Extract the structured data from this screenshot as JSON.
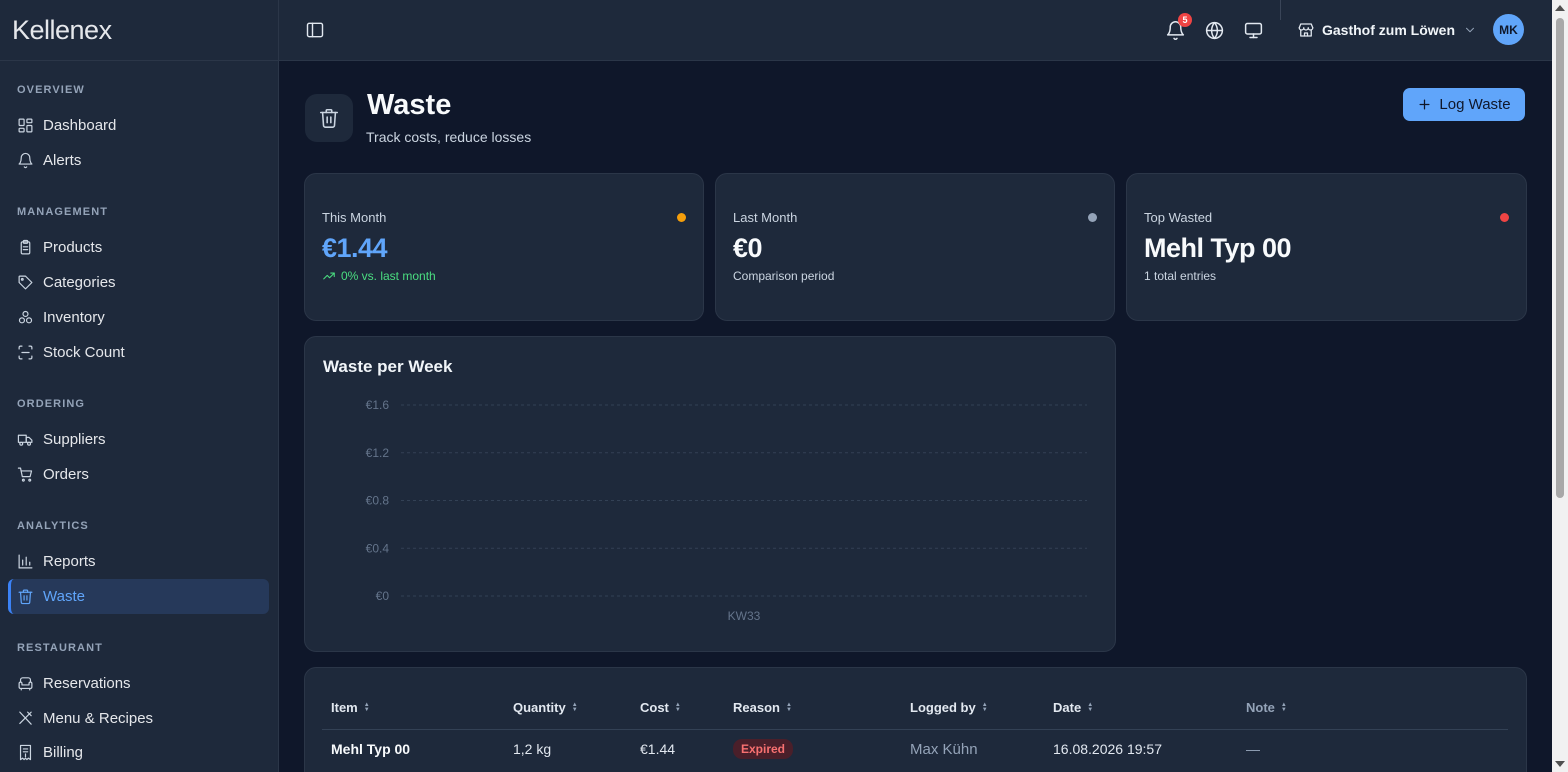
{
  "brand": {
    "name": "Kellenex"
  },
  "sidebar": {
    "sections": [
      {
        "title": "OVERVIEW",
        "items": [
          {
            "label": "Dashboard",
            "icon": "dashboard-icon"
          },
          {
            "label": "Alerts",
            "icon": "bell-icon"
          }
        ]
      },
      {
        "title": "MANAGEMENT",
        "items": [
          {
            "label": "Products",
            "icon": "clipboard-icon"
          },
          {
            "label": "Categories",
            "icon": "tag-icon"
          },
          {
            "label": "Inventory",
            "icon": "boxes-icon"
          },
          {
            "label": "Stock Count",
            "icon": "scan-icon"
          }
        ]
      },
      {
        "title": "ORDERING",
        "items": [
          {
            "label": "Suppliers",
            "icon": "truck-icon"
          },
          {
            "label": "Orders",
            "icon": "cart-icon"
          }
        ]
      },
      {
        "title": "ANALYTICS",
        "items": [
          {
            "label": "Reports",
            "icon": "bar-chart-icon"
          },
          {
            "label": "Waste",
            "icon": "trash-icon",
            "active": true
          }
        ]
      },
      {
        "title": "RESTAURANT",
        "items": [
          {
            "label": "Reservations",
            "icon": "armchair-icon"
          },
          {
            "label": "Menu & Recipes",
            "icon": "utensils-icon"
          },
          {
            "label": "Billing",
            "icon": "receipt-icon"
          }
        ]
      }
    ]
  },
  "topbar": {
    "notification_count": "5",
    "restaurant_name": "Gasthof zum Löwen",
    "user_initials": "MK"
  },
  "header": {
    "title": "Waste",
    "subtitle": "Track costs, reduce losses",
    "log_button": "Log Waste"
  },
  "stats": [
    {
      "label": "This Month",
      "value": "€1.44",
      "note": "0% vs. last month",
      "dot_color": "#f59e0b",
      "value_color": "#60a5fa",
      "note_color": "#4ade80"
    },
    {
      "label": "Last Month",
      "value": "€0",
      "note": "Comparison period",
      "dot_color": "#94a3b8",
      "value_color": "#f8fafc",
      "note_color": "#cbd5e1"
    },
    {
      "label": "Top Wasted",
      "value": "Mehl Typ 00",
      "note": "1 total entries",
      "dot_color": "#ef4444",
      "value_color": "#f8fafc",
      "note_color": "#cbd5e1"
    }
  ],
  "chart_data": {
    "type": "bar",
    "title": "Waste per Week",
    "categories": [
      "KW33"
    ],
    "values": [
      0
    ],
    "y_ticks": [
      "€0",
      "€0.4",
      "€0.8",
      "€1.2",
      "€1.6"
    ],
    "ylim": [
      0,
      1.6
    ],
    "grid": true
  },
  "table": {
    "columns": [
      "Item",
      "Quantity",
      "Cost",
      "Reason",
      "Logged by",
      "Date",
      "Note"
    ],
    "rows": [
      {
        "item": "Mehl Typ 00",
        "quantity": "1,2 kg",
        "cost": "€1.44",
        "reason": "Expired",
        "logged_by": "Max Kühn",
        "date": "16.08.2026 19:57",
        "note": "—"
      }
    ]
  }
}
